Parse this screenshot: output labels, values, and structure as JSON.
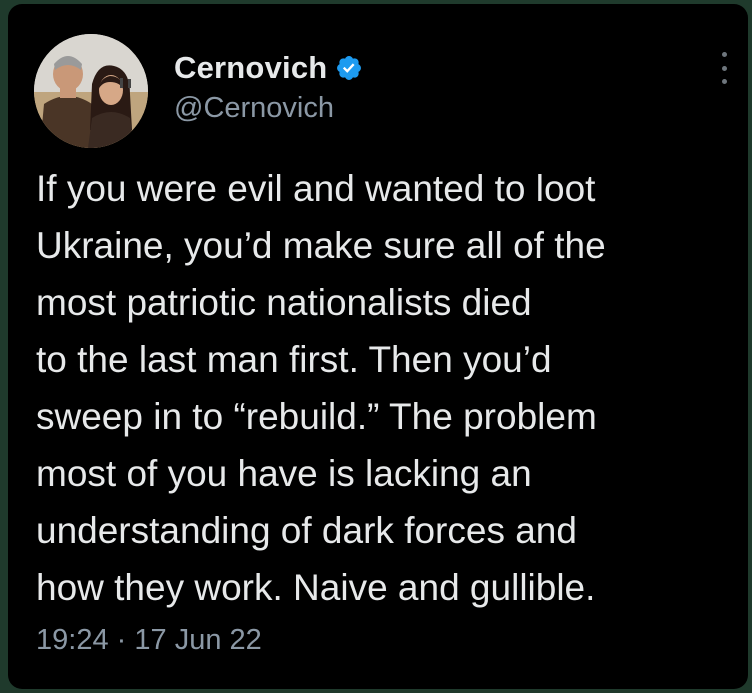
{
  "author": {
    "display_name": "Cernovich",
    "handle": "@Cernovich",
    "verified": true
  },
  "tweet": {
    "lines": [
      "If you were evil and wanted to loot",
      "Ukraine, you’d make sure all of the",
      "most patriotic nationalists died",
      "to the last man first. Then you’d",
      "sweep in to “rebuild.” The problem",
      "most of you have is lacking an",
      "understanding of dark forces and",
      "how they work. Naive and gullible."
    ],
    "time": "19:24",
    "separator": "·",
    "date": "17 Jun 22"
  },
  "colors": {
    "background": "#000000",
    "text": "#e7e9ea",
    "secondary": "#8b98a5",
    "verified_blue": "#1d9bf0",
    "outer_frame": "#1f3a2c"
  },
  "icons": {
    "verified": "verified-badge-icon",
    "more": "more-options-icon"
  }
}
